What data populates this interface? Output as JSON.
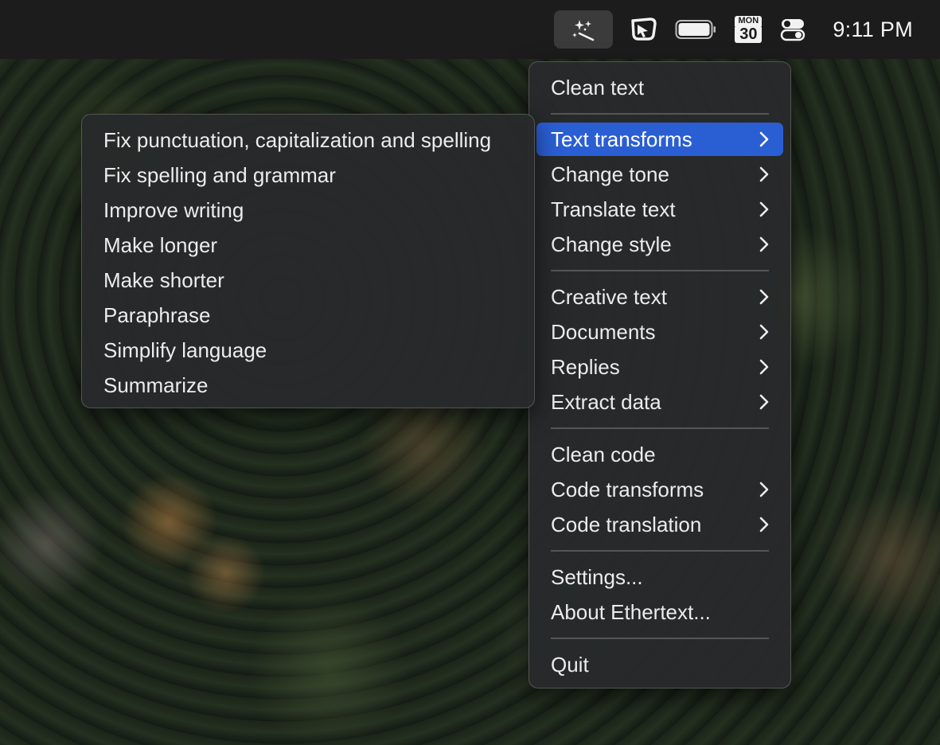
{
  "menubar": {
    "icons": [
      "magic-wand-icon",
      "shield-cursor-icon",
      "battery-icon",
      "calendar-icon",
      "control-center-icon"
    ],
    "calendar_day": "MON",
    "calendar_date": "30",
    "clock": "9:11 PM"
  },
  "main_menu": {
    "clean_text": "Clean text",
    "text_transforms": "Text transforms",
    "change_tone": "Change tone",
    "translate_text": "Translate text",
    "change_style": "Change style",
    "creative_text": "Creative text",
    "documents": "Documents",
    "replies": "Replies",
    "extract_data": "Extract data",
    "clean_code": "Clean code",
    "code_transforms": "Code transforms",
    "code_translation": "Code translation",
    "settings": "Settings...",
    "about": "About Ethertext...",
    "quit": "Quit"
  },
  "sub_menu": {
    "items": [
      "Fix punctuation, capitalization and spelling",
      "Fix spelling and grammar",
      "Improve writing",
      "Make longer",
      "Make shorter",
      "Paraphrase",
      "Simplify language",
      "Summarize"
    ]
  },
  "colors": {
    "highlight": "#2a5ed3",
    "menubar": "#1c1c1c",
    "menu_bg": "#282a2b"
  }
}
